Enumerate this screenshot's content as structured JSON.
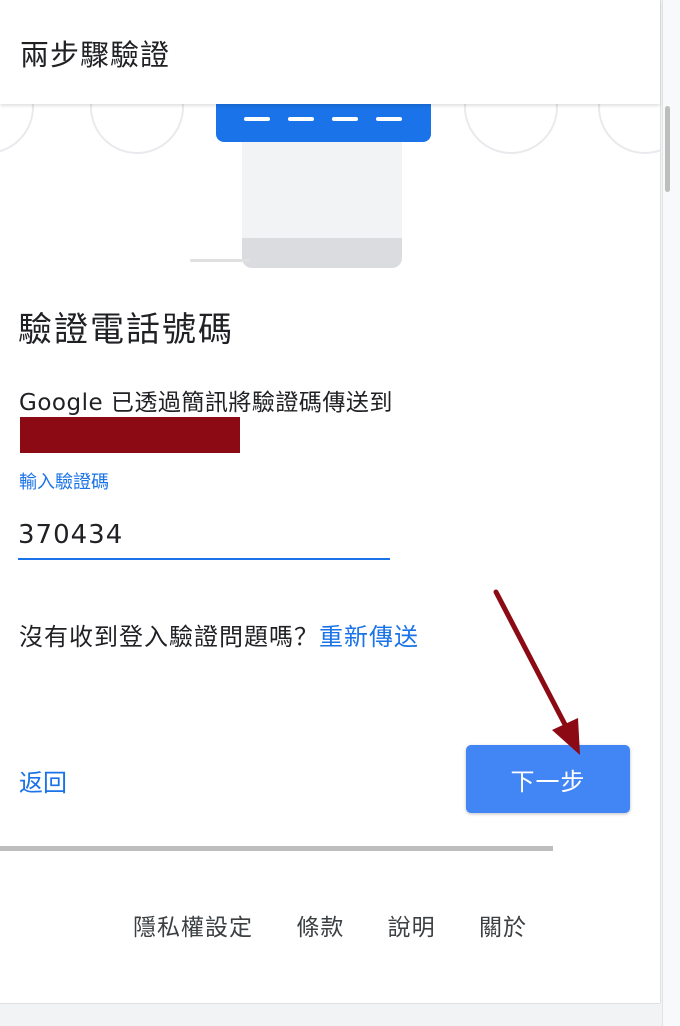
{
  "header": {
    "title": "兩步驟驗證"
  },
  "main": {
    "heading": "驗證電話號碼",
    "sent_text": "Google 已透過簡訊將驗證碼傳送到",
    "code_field": {
      "label": "輸入驗證碼",
      "value": "370434"
    },
    "resend_prompt": "沒有收到登入驗證問題嗎？",
    "resend_link": "重新傳送",
    "back_label": "返回",
    "next_label": "下一步"
  },
  "footer": {
    "links": [
      "隱私權設定",
      "條款",
      "說明",
      "關於"
    ]
  },
  "colors": {
    "accent": "#1a73e8",
    "button": "#4285f4",
    "redaction": "#8b0a14",
    "annotation_arrow": "#8b0a14"
  },
  "icons": {
    "illustration": "phone-sms-illustration",
    "annotation": "red-arrow-annotation"
  }
}
